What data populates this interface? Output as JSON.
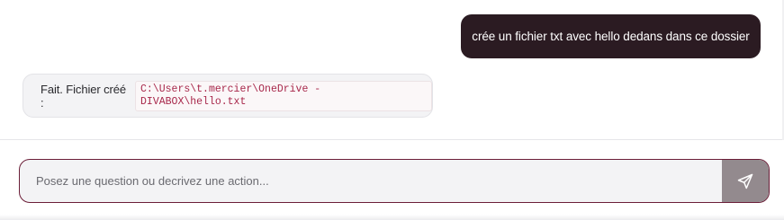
{
  "messages": {
    "user": {
      "text": "crée un fichier txt avec hello dedans dans ce dossier"
    },
    "assistant": {
      "prefix": "Fait. Fichier créé :",
      "path": "C:\\Users\\t.mercier\\OneDrive - DIVABOX\\hello.txt"
    }
  },
  "composer": {
    "placeholder": "Posez une question ou decrivez une action...",
    "value": ""
  },
  "icons": {
    "send": "paper-plane-icon"
  },
  "colors": {
    "user_bubble": "#2b1b22",
    "accent_border": "#6b1e38",
    "send_button": "#938a8e",
    "code_text": "#a8284b"
  }
}
